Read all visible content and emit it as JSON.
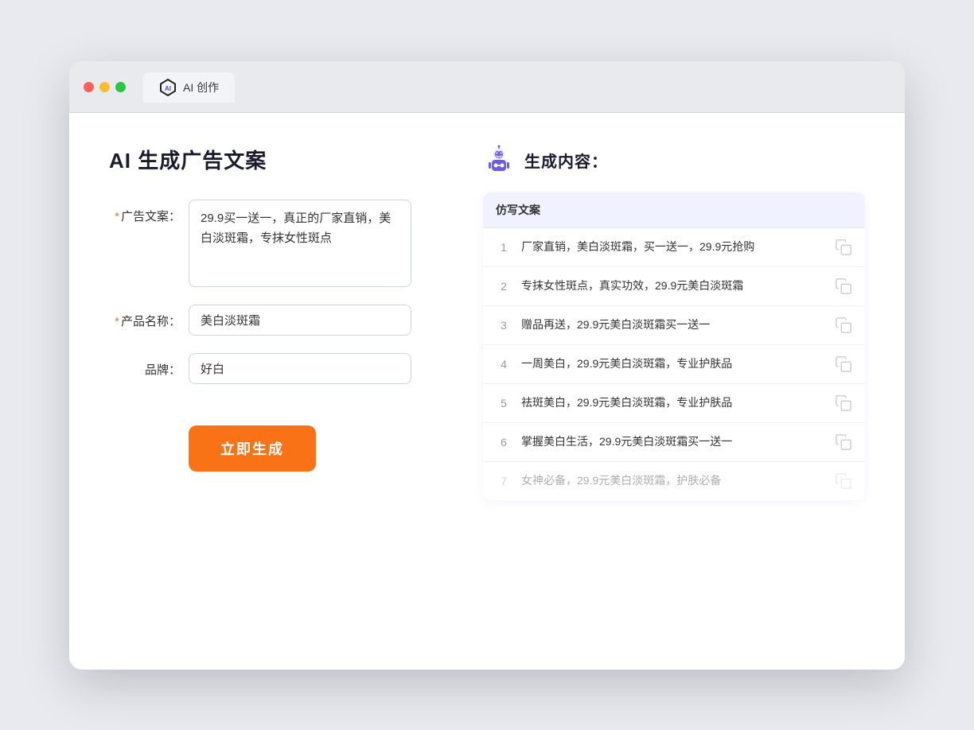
{
  "browser": {
    "tab_title": "AI 创作"
  },
  "page": {
    "title": "AI 生成广告文案",
    "result_title": "生成内容："
  },
  "form": {
    "ad_copy_label": "广告文案：",
    "ad_copy_required": "*",
    "ad_copy_value": "29.9买一送一，真正的厂家直销，美白淡斑霜，专抹女性斑点",
    "product_name_label": "产品名称：",
    "product_name_required": "*",
    "product_name_value": "美白淡斑霜",
    "brand_label": "品牌：",
    "brand_value": "好白",
    "generate_btn": "立即生成"
  },
  "result": {
    "table_header": "仿写文案",
    "rows": [
      {
        "num": "1",
        "text": "厂家直销，美白淡斑霜，买一送一，29.9元抢购",
        "faded": false
      },
      {
        "num": "2",
        "text": "专抹女性斑点，真实功效，29.9元美白淡斑霜",
        "faded": false
      },
      {
        "num": "3",
        "text": "赠品再送，29.9元美白淡斑霜买一送一",
        "faded": false
      },
      {
        "num": "4",
        "text": "一周美白，29.9元美白淡斑霜，专业护肤品",
        "faded": false
      },
      {
        "num": "5",
        "text": "祛斑美白，29.9元美白淡斑霜，专业护肤品",
        "faded": false
      },
      {
        "num": "6",
        "text": "掌握美白生活，29.9元美白淡斑霜买一送一",
        "faded": false
      },
      {
        "num": "7",
        "text": "女神必备，29.9元美白淡斑霜，护肤必备",
        "faded": true
      }
    ]
  }
}
